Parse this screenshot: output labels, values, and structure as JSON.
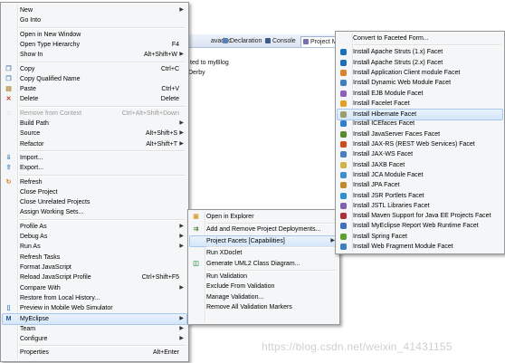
{
  "background": {
    "tabs": [
      {
        "label": "avadoc",
        "icon": "javadoc-icon",
        "color": "#6a8fc4"
      },
      {
        "label": "Declaration",
        "icon": "declaration-icon",
        "color": "#5b7fb5"
      },
      {
        "label": "Console",
        "icon": "console-icon",
        "color": "#3c5a8a"
      },
      {
        "label": "Project Migratio",
        "icon": "project-migration-icon",
        "color": "#7a6fb0"
      }
    ],
    "lines": [
      "ted to myBlog",
      "Derby"
    ]
  },
  "context_menu": {
    "items": [
      {
        "label": "New",
        "arrow": true
      },
      {
        "label": "Go Into"
      },
      {
        "sep": true
      },
      {
        "label": "Open in New Window"
      },
      {
        "label": "Open Type Hierarchy",
        "shortcut": "F4"
      },
      {
        "label": "Show In",
        "shortcut": "Alt+Shift+W",
        "arrow": true
      },
      {
        "sep": true
      },
      {
        "label": "Copy",
        "shortcut": "Ctrl+C",
        "icon": "copy-icon"
      },
      {
        "label": "Copy Qualified Name",
        "icon": "copy-qualified-name-icon"
      },
      {
        "label": "Paste",
        "shortcut": "Ctrl+V",
        "icon": "paste-icon"
      },
      {
        "label": "Delete",
        "shortcut": "Delete",
        "icon": "delete-icon"
      },
      {
        "sep": true
      },
      {
        "label": "Remove from Context",
        "shortcut": "Ctrl+Alt+Shift+Down",
        "disabled": true,
        "icon": "remove-context-icon"
      },
      {
        "label": "Build Path",
        "arrow": true
      },
      {
        "label": "Source",
        "shortcut": "Alt+Shift+S",
        "arrow": true
      },
      {
        "label": "Refactor",
        "shortcut": "Alt+Shift+T",
        "arrow": true
      },
      {
        "sep": true
      },
      {
        "label": "Import...",
        "icon": "import-icon"
      },
      {
        "label": "Export...",
        "icon": "export-icon"
      },
      {
        "sep": true
      },
      {
        "label": "Refresh",
        "icon": "refresh-icon"
      },
      {
        "label": "Close Project"
      },
      {
        "label": "Close Unrelated Projects"
      },
      {
        "label": "Assign Working Sets..."
      },
      {
        "sep": true
      },
      {
        "label": "Profile As",
        "arrow": true
      },
      {
        "label": "Debug As",
        "arrow": true
      },
      {
        "label": "Run As",
        "arrow": true
      },
      {
        "label": "Refresh Tasks"
      },
      {
        "label": "Format JavaScript"
      },
      {
        "label": "Reload JavaScript Profile",
        "shortcut": "Ctrl+Shift+F5"
      },
      {
        "label": "Compare With",
        "arrow": true
      },
      {
        "label": "Restore from Local History..."
      },
      {
        "label": "Preview in Mobile Web Simulator",
        "icon": "mobile-simulator-icon"
      },
      {
        "label": "MyEclipse",
        "arrow": true,
        "highlighted": true,
        "icon": "myeclipse-icon"
      },
      {
        "label": "Team",
        "arrow": true
      },
      {
        "label": "Configure",
        "arrow": true
      },
      {
        "sep": true
      },
      {
        "label": "Properties",
        "shortcut": "Alt+Enter"
      }
    ]
  },
  "myeclipse_menu": {
    "items": [
      {
        "label": "Open in Explorer",
        "icon": "folder-icon"
      },
      {
        "sep": true
      },
      {
        "label": "Add and Remove Project Deployments...",
        "icon": "deploy-icon"
      },
      {
        "label": "Project Facets [Capabilities]",
        "arrow": true,
        "highlighted": true
      },
      {
        "sep": true
      },
      {
        "label": "Run XDoclet"
      },
      {
        "label": "Generate UML2 Class Diagram...",
        "icon": "uml-icon"
      },
      {
        "sep": true
      },
      {
        "label": "Run Validation"
      },
      {
        "label": "Exclude From Validation"
      },
      {
        "label": "Manage Validation..."
      },
      {
        "label": "Remove All Validation Markers"
      }
    ]
  },
  "facets_menu": {
    "items": [
      {
        "label": "Convert to Faceted Form..."
      },
      {
        "sep": true
      },
      {
        "label": "Install Apache Struts (1.x) Facet",
        "icon": "struts-icon",
        "color": "#1c6fb8"
      },
      {
        "label": "Install Apache Struts (2.x) Facet",
        "icon": "struts-icon",
        "color": "#1c6fb8"
      },
      {
        "label": "Install Application Client module Facet",
        "icon": "app-client-icon",
        "color": "#d9822b"
      },
      {
        "label": "Install Dynamic Web Module Facet",
        "icon": "web-module-icon",
        "color": "#3f7fbf"
      },
      {
        "label": "Install EJB Module Facet",
        "icon": "ejb-icon",
        "color": "#8e5fb8"
      },
      {
        "label": "Install Facelet Facet",
        "icon": "facelet-icon",
        "color": "#e0a020"
      },
      {
        "label": "Install Hibernate Facet",
        "icon": "hibernate-icon",
        "color": "#9c9c6e",
        "highlighted": true
      },
      {
        "label": "Install ICEfaces Facet",
        "icon": "icefaces-icon",
        "color": "#2f7fd0"
      },
      {
        "label": "Install JavaServer Faces Facet",
        "icon": "jsf-icon",
        "color": "#5a8a2f"
      },
      {
        "label": "Install JAX-RS (REST Web Services) Facet",
        "icon": "jaxrs-icon",
        "color": "#d04a1e"
      },
      {
        "label": "Install JAX-WS Facet",
        "icon": "jaxws-icon",
        "color": "#4a7fbf"
      },
      {
        "label": "Install JAXB Facet",
        "icon": "jaxb-icon",
        "color": "#d2b24a"
      },
      {
        "label": "Install JCA Module Facet",
        "icon": "jca-icon",
        "color": "#3f8fd0"
      },
      {
        "label": "Install JPA Facet",
        "icon": "jpa-icon",
        "color": "#c08a2a"
      },
      {
        "label": "Install JSR Portlets Facet",
        "icon": "portlets-icon",
        "color": "#2f8fd0"
      },
      {
        "label": "Install JSTL Libraries Facet",
        "icon": "jstl-icon",
        "color": "#7f5fb0"
      },
      {
        "label": "Install Maven Support for Java EE Projects Facet",
        "icon": "maven-icon",
        "color": "#b0303a"
      },
      {
        "label": "Install MyEclipse Report Web Runtime Facet",
        "icon": "report-icon",
        "color": "#3f6fbf"
      },
      {
        "label": "Install Spring Facet",
        "icon": "spring-icon",
        "color": "#5aa02c"
      },
      {
        "label": "Install Web Fragment Module Facet",
        "icon": "web-fragment-icon",
        "color": "#3f7fbf"
      }
    ]
  },
  "watermark": "https://blog.csdn.net/weixin_41431155"
}
